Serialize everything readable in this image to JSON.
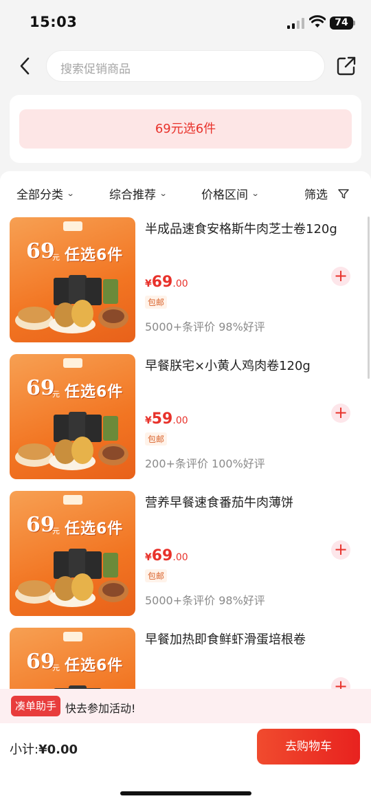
{
  "status_bar": {
    "time": "15:03",
    "battery": "74"
  },
  "nav": {
    "search_placeholder": "搜索促销商品"
  },
  "promo": {
    "banner_text": "69元选6件"
  },
  "filters": [
    {
      "label": "全部分类",
      "icon": "chevron-down-icon"
    },
    {
      "label": "综合推荐",
      "icon": "chevron-down-icon"
    },
    {
      "label": "价格区间",
      "icon": "chevron-down-icon"
    },
    {
      "label": "筛选",
      "icon": "filter-icon"
    }
  ],
  "thumb_overlay": {
    "price": "69",
    "unit": "元",
    "slogan": "任选6件"
  },
  "products": [
    {
      "title": "半成品速食安格斯牛肉芝士卷120g",
      "price_symbol": "¥",
      "price_int": "69",
      "price_dec": ".00",
      "badge": "包邮",
      "reviews": "5000+条评价   98%好评"
    },
    {
      "title": "早餐朕宅×小黄人鸡肉卷120g",
      "price_symbol": "¥",
      "price_int": "59",
      "price_dec": ".00",
      "badge": "包邮",
      "reviews": "200+条评价   100%好评"
    },
    {
      "title": "营养早餐速食番茄牛肉薄饼",
      "price_symbol": "¥",
      "price_int": "69",
      "price_dec": ".00",
      "badge": "包邮",
      "reviews": "5000+条评价   98%好评"
    },
    {
      "title": "早餐加热即食鲜虾滑蛋培根卷",
      "price_symbol": "¥",
      "price_int": "",
      "price_dec": "",
      "badge": "",
      "reviews": ""
    }
  ],
  "helper": {
    "tag": "凑单助手",
    "text": "快去参加活动!"
  },
  "footer": {
    "subtotal_label": "小计:",
    "subtotal_value": "¥0.00",
    "cart_button": "去购物车"
  },
  "colors": {
    "accent": "#e8322b",
    "promo_bg": "#fde6e6",
    "thumb_orange": "#f27522"
  }
}
